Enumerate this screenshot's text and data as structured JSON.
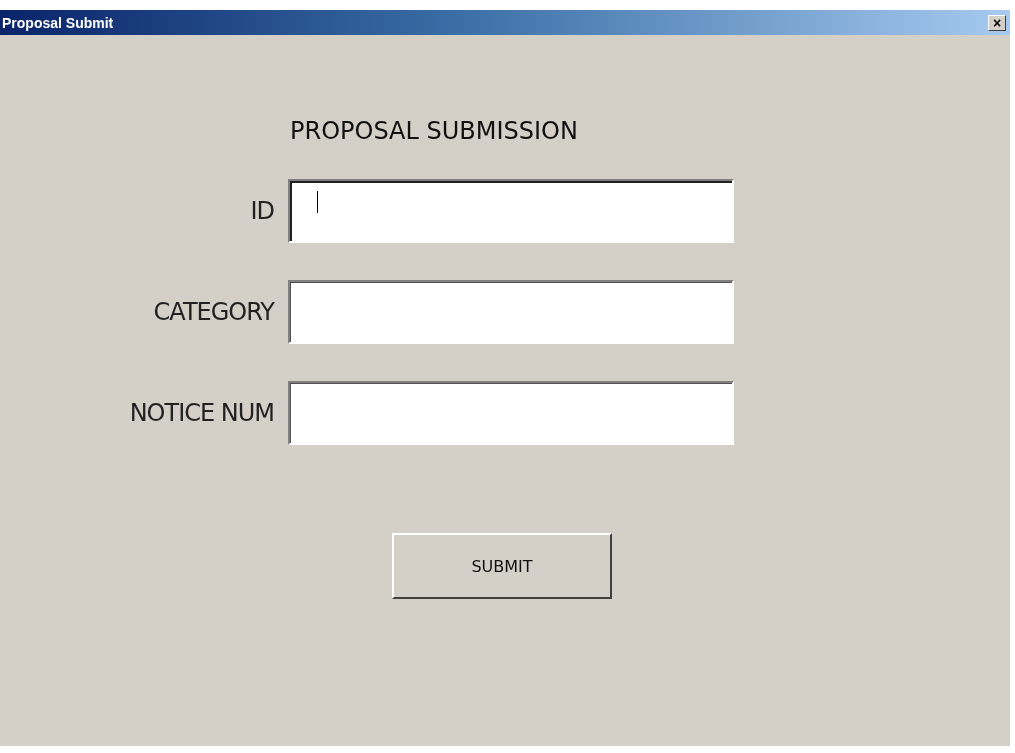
{
  "window": {
    "title": "Proposal Submit",
    "close": "×"
  },
  "heading": "PROPOSAL SUBMISSION",
  "fields": [
    {
      "label": "ID",
      "focused": true
    },
    {
      "label": "CATEGORY",
      "focused": false
    },
    {
      "label": "NOTICE NUM",
      "focused": false
    }
  ],
  "submit": "SUBMIT"
}
